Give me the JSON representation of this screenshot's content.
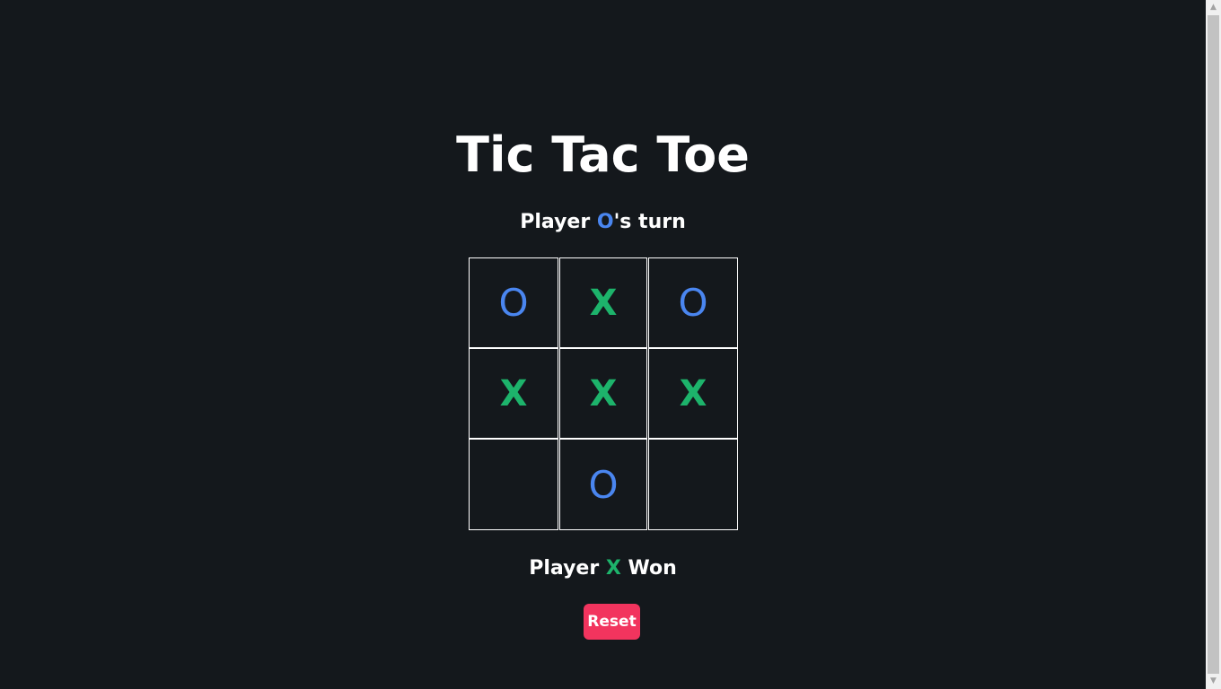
{
  "game": {
    "title": "Tic Tac Toe",
    "turn": {
      "prefix": "Player ",
      "player": "O",
      "suffix": "'s turn"
    },
    "board": [
      "O",
      "X",
      "O",
      "X",
      "X",
      "X",
      "",
      "O",
      ""
    ],
    "result": {
      "prefix": "Player ",
      "player": "X",
      "suffix": " Won"
    },
    "reset_label": "Reset"
  },
  "colors": {
    "background": "#14181c",
    "player_o": "#4a86f0",
    "player_x": "#1db36b",
    "reset_button": "#f2345e"
  },
  "scrollbar": {
    "up_icon": "scroll-up-arrow-icon",
    "down_icon": "scroll-down-arrow-icon",
    "up_glyph": "▲",
    "down_glyph": "▼"
  }
}
